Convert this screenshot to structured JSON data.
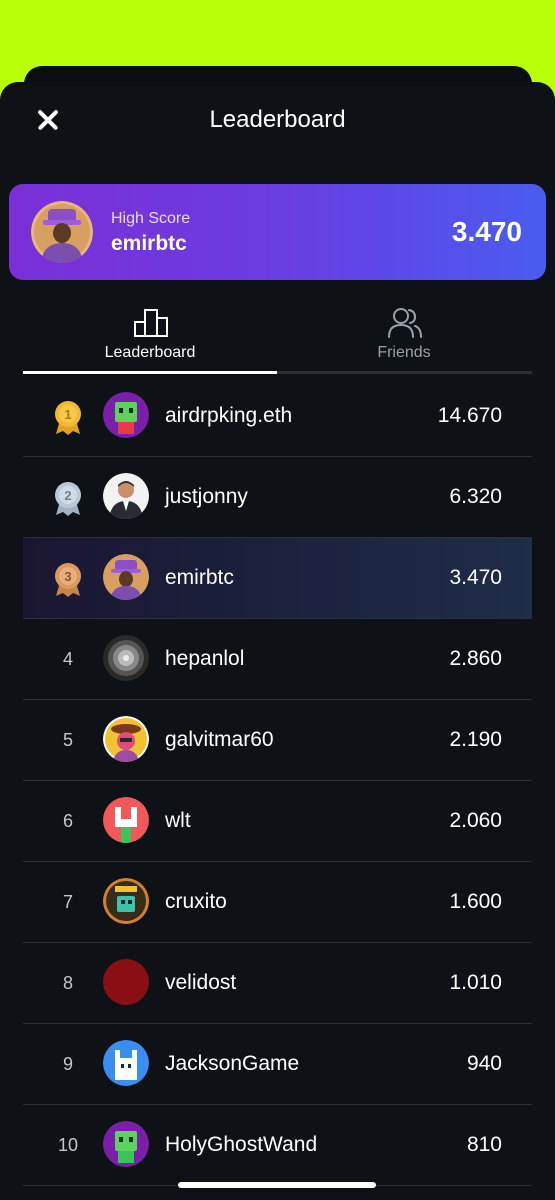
{
  "header": {
    "title": "Leaderboard"
  },
  "high_score": {
    "label": "High Score",
    "username": "emirbtc",
    "score": "3.470"
  },
  "tabs": [
    {
      "label": "Leaderboard",
      "icon": "podium-icon",
      "active": true
    },
    {
      "label": "Friends",
      "icon": "friends-icon",
      "active": false
    }
  ],
  "leaderboard": [
    {
      "rank": "1",
      "medal": "gold",
      "username": "airdrpking.eth",
      "score": "14.670",
      "avatar": "green-robot-avatar"
    },
    {
      "rank": "2",
      "medal": "silver",
      "username": "justjonny",
      "score": "6.320",
      "avatar": "portrait-avatar"
    },
    {
      "rank": "3",
      "medal": "bronze",
      "username": "emirbtc",
      "score": "3.470",
      "avatar": "purple-hat-avatar"
    },
    {
      "rank": "4",
      "username": "hepanlol",
      "score": "2.860",
      "avatar": "grayscale-avatar"
    },
    {
      "rank": "5",
      "username": "galvitmar60",
      "score": "2.190",
      "avatar": "yellow-character-avatar"
    },
    {
      "rank": "6",
      "username": "wlt",
      "score": "2.060",
      "avatar": "red-robot-avatar"
    },
    {
      "rank": "7",
      "username": "cruxito",
      "score": "1.600",
      "avatar": "games-avatar"
    },
    {
      "rank": "8",
      "username": "velidost",
      "score": "1.010",
      "avatar": "dark-red-avatar"
    },
    {
      "rank": "9",
      "username": "JacksonGame",
      "score": "940",
      "avatar": "blue-robot-avatar"
    },
    {
      "rank": "10",
      "username": "HolyGhostWand",
      "score": "810",
      "avatar": "green-robot-avatar"
    }
  ],
  "colors": {
    "background": "#b9ff0a",
    "panel": "#0e1216",
    "accent_gradient_start": "#7a2fd6",
    "accent_gradient_end": "#4a5cf0",
    "gold": "#f4b731",
    "silver": "#b9c9d8",
    "bronze": "#d99a5b"
  }
}
